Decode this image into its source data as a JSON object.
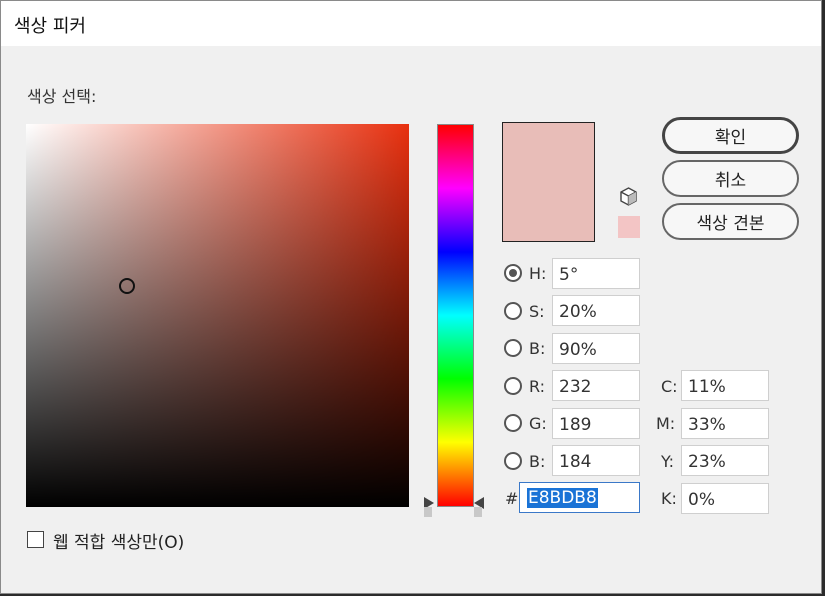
{
  "window": {
    "title": "색상 피커"
  },
  "picker": {
    "select_label": "색상 선택:"
  },
  "current_color": "#E8BDB8",
  "web_color": "#F3C5C5",
  "buttons": {
    "ok": "확인",
    "cancel": "취소",
    "swatches": "색상 견본"
  },
  "hsb": {
    "h_label": "H:",
    "h_value": "5°",
    "s_label": "S:",
    "s_value": "20%",
    "b_label": "B:",
    "b_value": "90%",
    "selected": "H"
  },
  "rgb": {
    "r_label": "R:",
    "r_value": "232",
    "g_label": "G:",
    "g_value": "189",
    "b_label": "B:",
    "b_value": "184"
  },
  "cmyk": {
    "c_label": "C:",
    "c_value": "11%",
    "m_label": "M:",
    "m_value": "33%",
    "y_label": "Y:",
    "y_value": "23%",
    "k_label": "K:",
    "k_value": "0%"
  },
  "hex": {
    "label": "#",
    "value": "E8BDB8"
  },
  "web_only": {
    "label": "웹 적합 색상만(O)",
    "checked": false
  },
  "icons": {
    "gamut_warning": "cube-icon",
    "web_safe": "web-swatch"
  }
}
